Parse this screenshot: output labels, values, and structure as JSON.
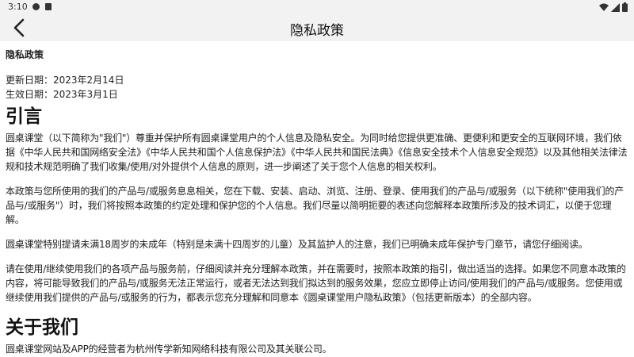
{
  "status_bar": {
    "time": "3:10"
  },
  "app_bar": {
    "title": "隐私政策",
    "back_icon": "chevron-left-icon"
  },
  "document": {
    "title": "隐私政策",
    "updated": "更新日期：2023年2月14日",
    "effective": "生效日期：2023年3月1日",
    "sections": [
      {
        "heading": "引言",
        "paragraphs": [
          "圆桌课堂（以下简称为\"我们\"）尊重并保护所有圆桌课堂用户的个人信息及隐私安全。为同时给您提供更准确、更便利和更安全的互联网环境，我们依据《中华人民共和国网络安全法》《中华人民共和国个人信息保护法》《中华人民共和国民法典》《信息安全技术个人信息安全规范》以及其他相关法律法规和技术规范明确了我们收集/使用/对外提供个人信息的原则，进一步阐述了关于您个人信息的相关权利。",
          "本政策与您所使用的我们的产品与/或服务息息相关，您在下载、安装、启动、浏览、注册、登录、使用我们的产品与/或服务（以下统称\"使用我们的产品与/或服务\"）时，我们将按照本政策的约定处理和保护您的个人信息。我们尽量以简明扼要的表述向您解释本政策所涉及的技术词汇，以便于您理解。",
          "圆桌课堂特别提请未满18周岁的未成年（特别是未满十四周岁的儿童）及其监护人的注意，我们已明确未成年保护专门章节，请您仔细阅读。",
          "请在使用/继续使用我们的各项产品与服务前，仔细阅读并充分理解本政策，并在需要时，按照本政策的指引，做出适当的选择。如果您不同意本政策的内容，将可能导致我们的产品与/或服务无法正常运行，或者无法达到我们拟达到的服务效果，您应立即停止访问/使用我们的产品与/或服务。您使用或继续使用我们提供的产品与/或服务的行为，都表示您充分理解和同意本《圆桌课堂用户隐私政策》（包括更新版本）的全部内容。"
        ]
      },
      {
        "heading": "关于我们",
        "paragraphs": [
          "圆桌课堂网站及APP的经营者为杭州传学新知网络科技有限公司及其关联公司。"
        ]
      }
    ]
  }
}
